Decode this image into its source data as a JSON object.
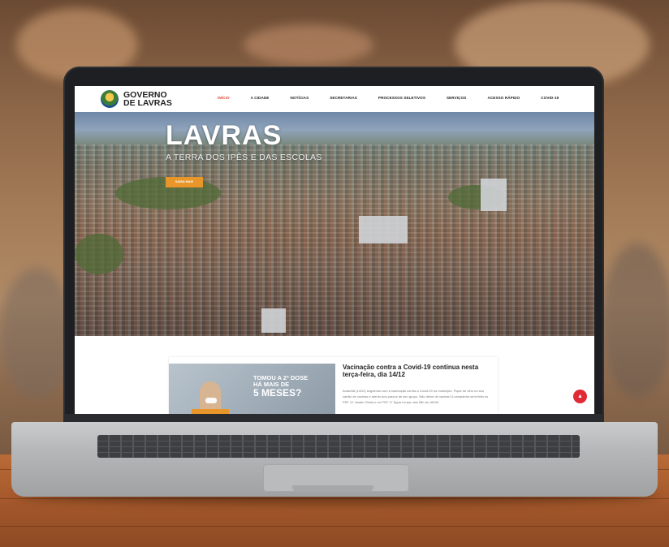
{
  "site": {
    "logo_line1": "GOVERNO",
    "logo_line2": "DE LAVRAS",
    "menu": [
      "INÍCIO",
      "A CIDADE",
      "NOTÍCIAS",
      "SECRETARIAS",
      "PROCESSOS SELETIVOS",
      "SERVIÇOS",
      "ACESSO RÁPIDO",
      "COVID-19"
    ],
    "active_menu": "INÍCIO",
    "accent_color": "#e2422e"
  },
  "hero": {
    "title": "LAVRAS",
    "subtitle": "A TERRA DOS IPÊS E DAS ESCOLAS",
    "button_label": "SAIBA MAIS",
    "button_color": "#e8952a"
  },
  "news": {
    "image_line1": "TOMOU A 2ª DOSE",
    "image_line2": "HÁ MAIS DE",
    "image_line3": "5 MESES?",
    "title": "Vacinação contra a Covid-19 continua nesta terça-feira, dia 14/12",
    "excerpt": "Amanhã (14/12) seguimos com a vacinação contra a Covid-19 no município. Fique de olho no seu cartão de vacinas e atento aos prazos de seu grupo. Não deixe de vacinar! A campanha será feita no PSF 12 Jardim Glória e no PSF 17 Água Limpa, das 08h às 16h00."
  },
  "fab": {
    "color": "#e02a35",
    "icon": "chevron-up-icon"
  }
}
